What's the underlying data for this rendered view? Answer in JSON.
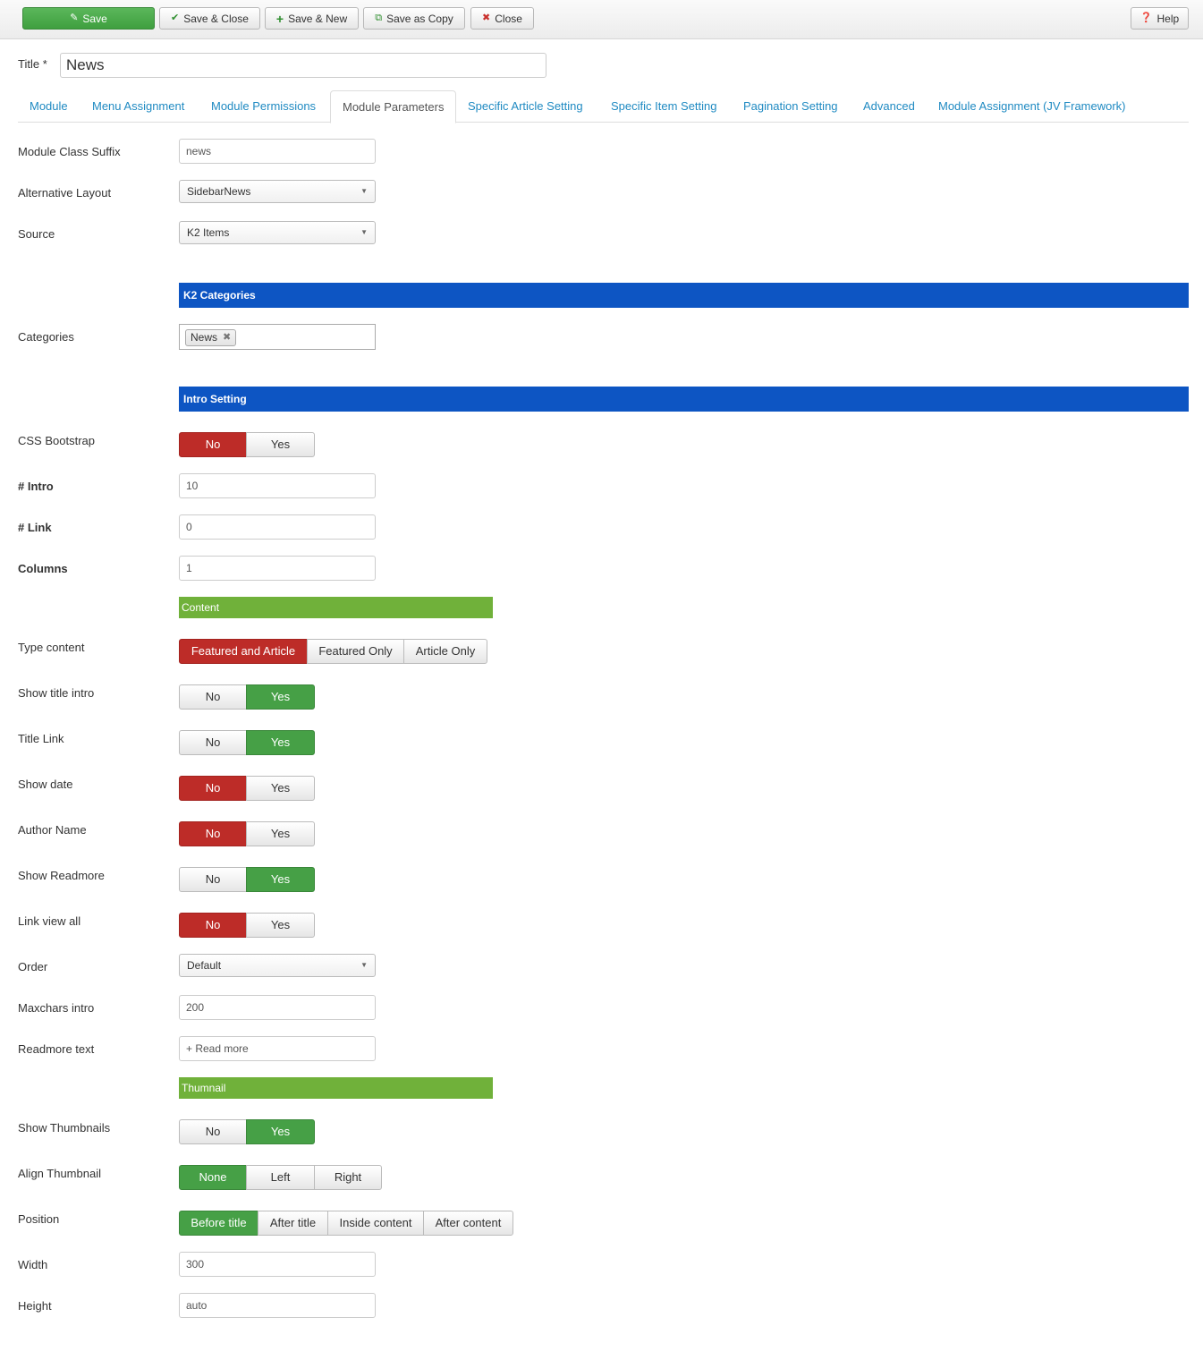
{
  "toolbar": {
    "save": "Save",
    "save_close": "Save & Close",
    "save_new": "Save & New",
    "save_copy": "Save as Copy",
    "close": "Close",
    "help": "Help"
  },
  "title": {
    "label": "Title *",
    "value": "News"
  },
  "tabs": [
    "Module",
    "Menu Assignment",
    "Module Permissions",
    "Module Parameters",
    "Specific Article Setting",
    "Specific Item Setting",
    "Pagination Setting",
    "Advanced",
    "Module Assignment (JV Framework)"
  ],
  "active_tab": "Module Parameters",
  "fields": {
    "module_class_suffix": {
      "label": "Module Class Suffix",
      "value": "news"
    },
    "alternative_layout": {
      "label": "Alternative Layout",
      "value": "SidebarNews"
    },
    "source": {
      "label": "Source",
      "value": "K2 Items"
    },
    "k2_categories_header": "K2 Categories",
    "categories": {
      "label": "Categories",
      "chip": "News"
    },
    "intro_header": "Intro Setting",
    "css_bootstrap": {
      "label": "CSS Bootstrap",
      "options": [
        "No",
        "Yes"
      ],
      "selected": "No"
    },
    "intro": {
      "label": "# Intro",
      "value": "10"
    },
    "link": {
      "label": "# Link",
      "value": "0"
    },
    "columns": {
      "label": "Columns",
      "value": "1"
    },
    "content_header": "Content",
    "type_content": {
      "label": "Type content",
      "options": [
        "Featured and Article",
        "Featured Only",
        "Article Only"
      ],
      "selected": "Featured and Article"
    },
    "show_title_intro": {
      "label": "Show title intro",
      "options": [
        "No",
        "Yes"
      ],
      "selected": "Yes"
    },
    "title_link": {
      "label": "Title Link",
      "options": [
        "No",
        "Yes"
      ],
      "selected": "Yes"
    },
    "show_date": {
      "label": "Show date",
      "options": [
        "No",
        "Yes"
      ],
      "selected": "No"
    },
    "author_name": {
      "label": "Author Name",
      "options": [
        "No",
        "Yes"
      ],
      "selected": "No"
    },
    "show_readmore": {
      "label": "Show Readmore",
      "options": [
        "No",
        "Yes"
      ],
      "selected": "Yes"
    },
    "link_view_all": {
      "label": "Link view all",
      "options": [
        "No",
        "Yes"
      ],
      "selected": "No"
    },
    "order": {
      "label": "Order",
      "value": "Default"
    },
    "maxchars_intro": {
      "label": "Maxchars intro",
      "value": "200"
    },
    "readmore_text": {
      "label": "Readmore text",
      "value": "+ Read more"
    },
    "thumbnail_header": "Thumnail",
    "show_thumbnails": {
      "label": "Show Thumbnails",
      "options": [
        "No",
        "Yes"
      ],
      "selected": "Yes"
    },
    "align_thumbnail": {
      "label": "Align Thumbnail",
      "options": [
        "None",
        "Left",
        "Right"
      ],
      "selected": "None"
    },
    "position": {
      "label": "Position",
      "options": [
        "Before title",
        "After title",
        "Inside content",
        "After content"
      ],
      "selected": "Before title"
    },
    "width": {
      "label": "Width",
      "value": "300"
    },
    "height": {
      "label": "Height",
      "value": "auto"
    }
  },
  "colors": {
    "accent_blue": "#0d55c3",
    "section_green": "#70b13a",
    "active_red": "#bd2c28",
    "active_green": "#46a046",
    "link": "#1f8ac2"
  }
}
